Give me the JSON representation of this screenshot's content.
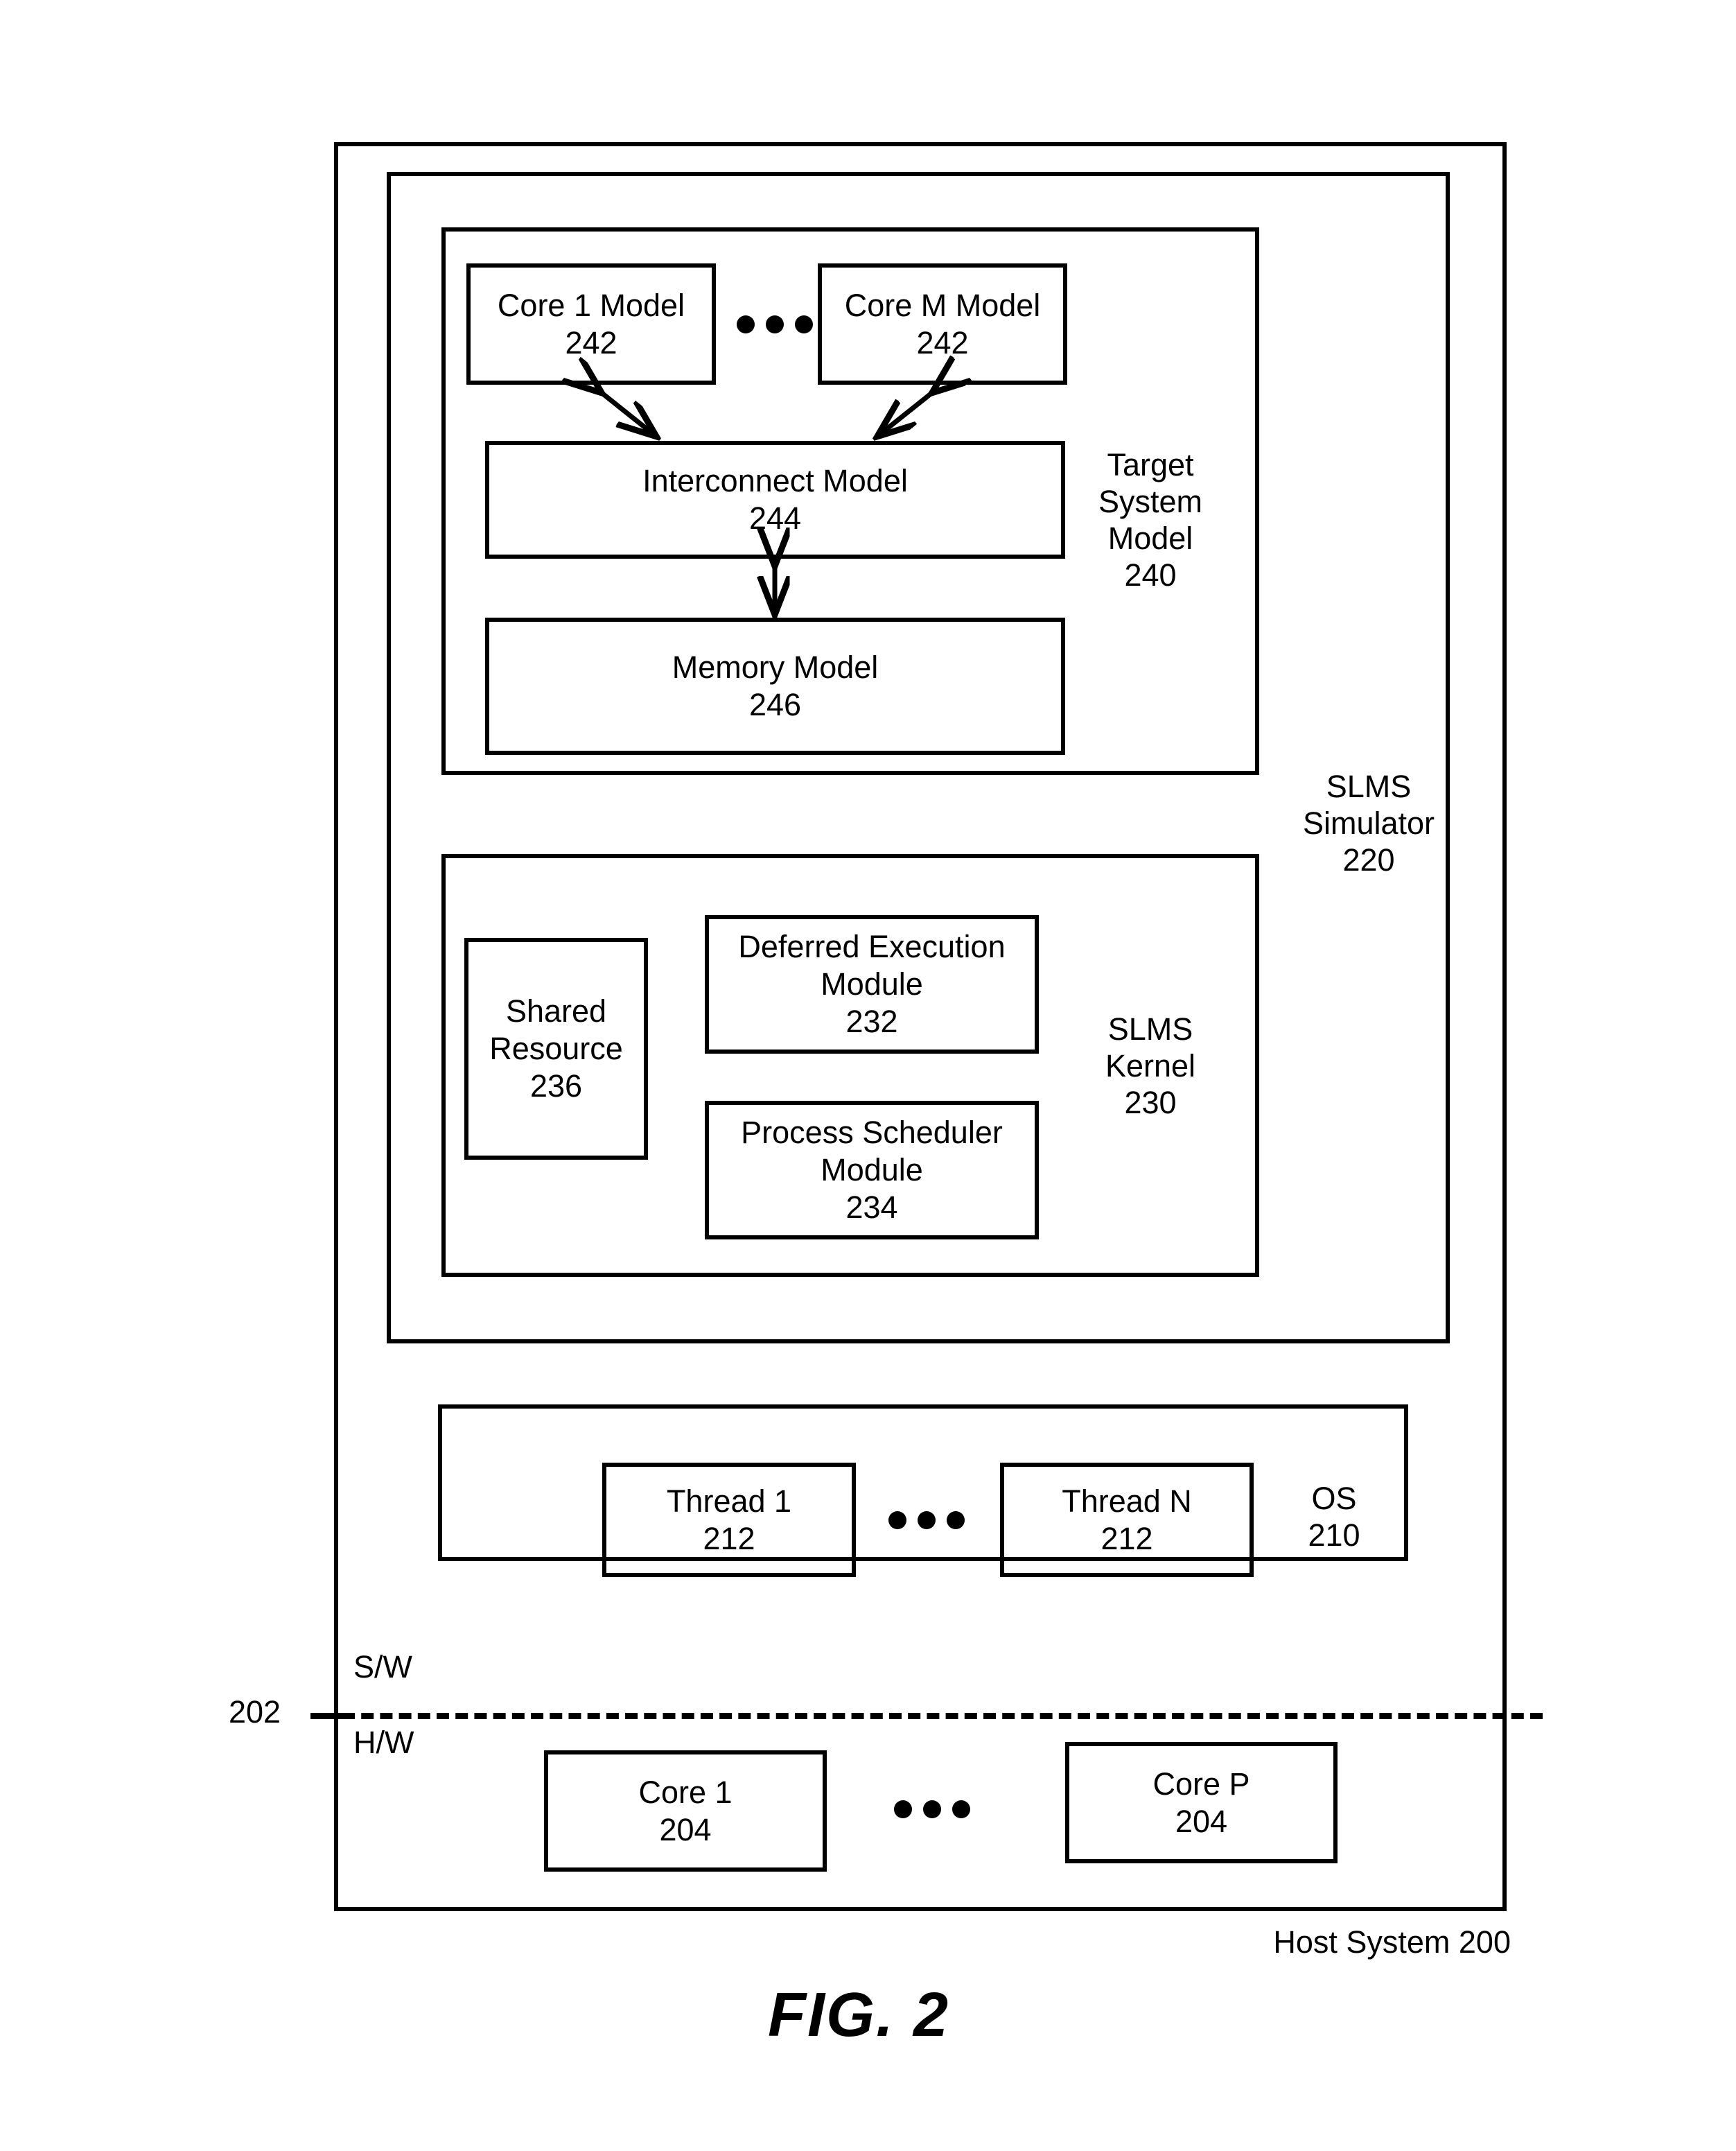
{
  "figure": {
    "caption": "FIG. 2",
    "host_system_label": "Host System 200",
    "boundary": {
      "ref": "202",
      "upper_label": "S/W",
      "lower_label": "H/W"
    }
  },
  "slms_simulator": {
    "label": "SLMS\nSimulator\n220"
  },
  "target_system_model": {
    "label": "Target\nSystem\nModel\n240",
    "core_models": [
      {
        "name": "Core 1 Model",
        "ref": "242"
      },
      {
        "name": "Core M Model",
        "ref": "242"
      }
    ],
    "core_ellipsis": "...",
    "interconnect_model": {
      "name": "Interconnect Model",
      "ref": "244"
    },
    "memory_model": {
      "name": "Memory Model",
      "ref": "246"
    }
  },
  "slms_kernel": {
    "label": "SLMS\nKernel\n230",
    "shared_resource": {
      "name": "Shared\nResource",
      "ref": "236"
    },
    "deferred_execution_module": {
      "name": "Deferred Execution\nModule",
      "ref": "232"
    },
    "process_scheduler_module": {
      "name": "Process Scheduler\nModule",
      "ref": "234"
    }
  },
  "os": {
    "label": "OS\n210",
    "threads": [
      {
        "name": "Thread 1",
        "ref": "212"
      },
      {
        "name": "Thread N",
        "ref": "212"
      }
    ],
    "thread_ellipsis": "..."
  },
  "hardware": {
    "cores": [
      {
        "name": "Core 1",
        "ref": "204"
      },
      {
        "name": "Core P",
        "ref": "204"
      }
    ],
    "core_ellipsis": "..."
  },
  "colors": {
    "stroke": "#000000",
    "background": "#ffffff"
  }
}
